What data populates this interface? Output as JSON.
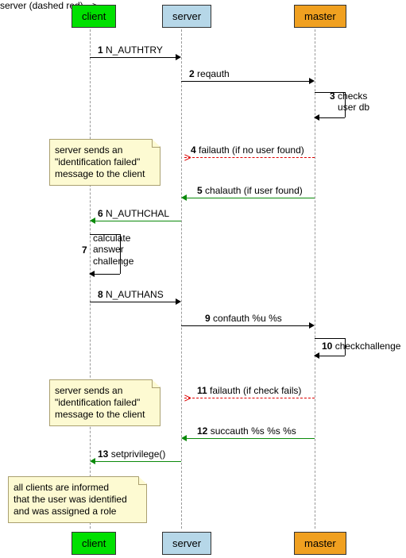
{
  "participants": {
    "client": "client",
    "server": "server",
    "master": "master"
  },
  "messages": {
    "m1": {
      "num": "1",
      "label": "N_AUTHTRY"
    },
    "m2": {
      "num": "2",
      "label": "reqauth"
    },
    "m3": {
      "num": "3",
      "label": "checks\nuser db"
    },
    "m4": {
      "num": "4",
      "label": "failauth (if no user found)"
    },
    "m5": {
      "num": "5",
      "label": "chalauth (if user found)"
    },
    "m6": {
      "num": "6",
      "label": "N_AUTHCHAL"
    },
    "m7": {
      "num": "7",
      "label": "calculate\nanswer\nchallenge"
    },
    "m8": {
      "num": "8",
      "label": "N_AUTHANS"
    },
    "m9": {
      "num": "9",
      "label": "confauth %u %s"
    },
    "m10": {
      "num": "10",
      "label": "checkchallenge"
    },
    "m11": {
      "num": "11",
      "label": "failauth (if check fails)"
    },
    "m12": {
      "num": "12",
      "label": "succauth %s %s %s"
    },
    "m13": {
      "num": "13",
      "label": "setprivilege()"
    }
  },
  "notes": {
    "n1": "server sends an\n\"identification failed\"\nmessage to the client",
    "n2": "server sends an\n\"identification failed\"\nmessage to the client",
    "n3": "all clients are informed\nthat the user was identified\nand was assigned a role"
  }
}
